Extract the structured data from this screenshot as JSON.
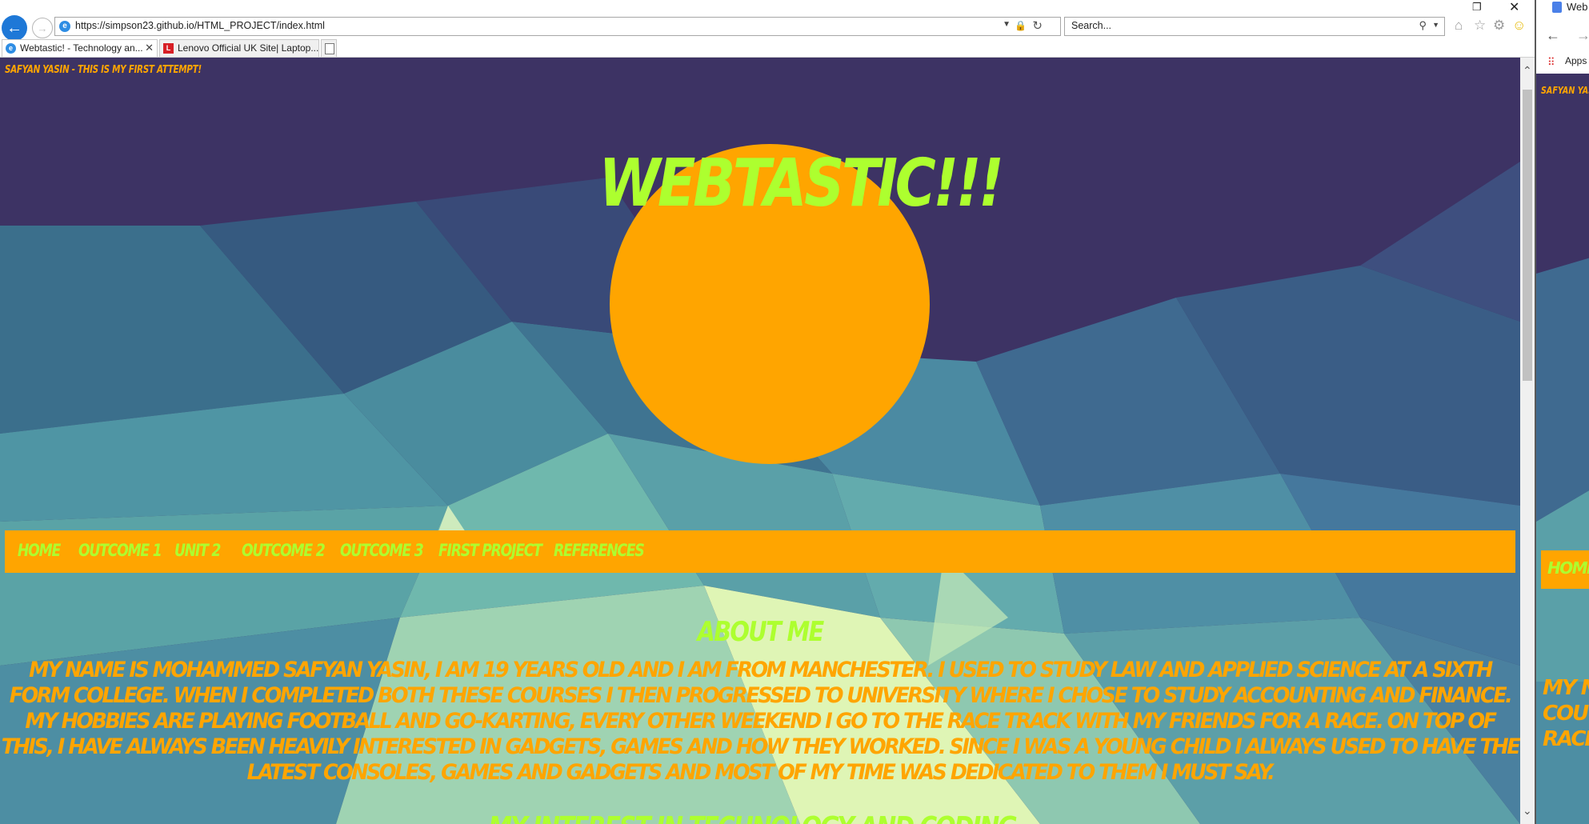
{
  "browser": {
    "window_controls": {
      "minimize": "—",
      "restore": "❐",
      "close": "✕"
    },
    "back_icon": "←",
    "forward_icon": "→",
    "url": "https://simpson23.github.io/HTML_PROJECT/index.html",
    "search_placeholder": "Search...",
    "tabs": [
      {
        "title": "Webtastic! - Technology an...",
        "active": true,
        "close": "✕"
      },
      {
        "title": "Lenovo Official UK Site| Laptop...",
        "active": false
      }
    ]
  },
  "site": {
    "tagline": "Safyan Yasin - This is my first attempt!",
    "title": "WEBTASTIC!!!",
    "nav": [
      "Home",
      "Outcome 1",
      "Unit 2",
      "Outcome 2",
      "Outcome 3",
      "First Project",
      "References"
    ],
    "about_heading": "About Me",
    "about_text": "My name is Mohammed Safyan Yasin, I am 19 years old and I am from Manchester. I used to study Law and Applied Science at a sixth form college. When I completed both these courses I then progressed to university where I chose to study Accounting and Finance. My hobbies are playing football and go-karting, every other weekend I go to the race track with my friends for a race. On top of this, I have always been heavily interested in gadgets, games and how they worked. Since I was a young child I always used to have the latest consoles, games and gadgets and most of my time was dedicated to them I must say.",
    "interest_heading": "My Interest in Technology and Coding"
  },
  "chrome": {
    "tab_title": "Web",
    "apps_label": "Apps",
    "tagline": "Safyan Yas",
    "nav_home": "Home",
    "text": "My na\ncou\nrace t"
  },
  "colors": {
    "background": "#3d3364",
    "accent_orange": "#ffa500",
    "accent_green": "#adff2f",
    "ie_blue": "#1e78d7"
  }
}
